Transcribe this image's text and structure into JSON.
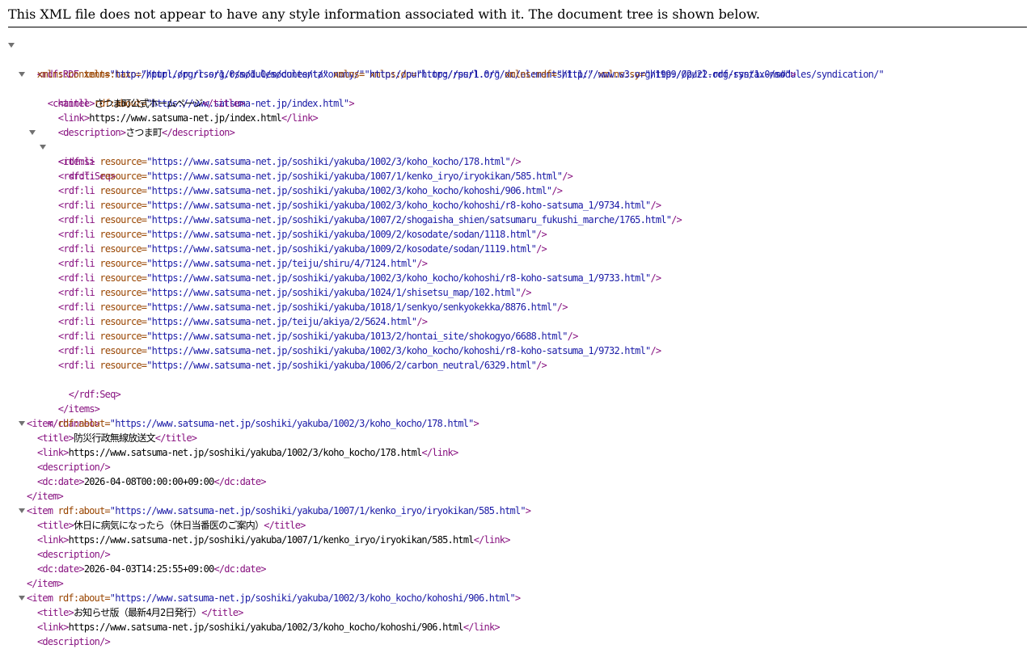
{
  "notice": "This XML file does not appear to have any style information associated with it. The document tree is shown below.",
  "tree": {
    "rdf_open": {
      "tag": "<rdf:RDF",
      "attrs1": [
        {
          "name": " xmlns:taxo=",
          "value": "\"http://purl.org/rss/1.0/modules/taxonomy/\""
        },
        {
          "name": " xmlns:dc=",
          "value": "\"http://purl.org/dc/elements/1.1/\""
        },
        {
          "name": " xmlns:sy=",
          "value": "\"http://purl.org/rss/1.0/modules/syndication/\""
        }
      ],
      "attrs2": [
        {
          "name": "xmlns:content=",
          "value": "\"http://purl.org/rss/1.0/modules/content/\""
        },
        {
          "name": " xmlns=",
          "value": "\"http://purl.org/rss/1.0/\""
        },
        {
          "name": " xmlns:rdf=",
          "value": "\"http://www.w3.org/1999/02/22-rdf-syntax-ns#\""
        }
      ],
      "close": ">"
    },
    "channel": {
      "open": "<channel",
      "attr_name": " rdf:about=",
      "attr_value": "\"https://www.satsuma-net.jp/index.html\"",
      "gt": ">",
      "title": {
        "open": "<title>",
        "text": "さつま町公式ホームページ",
        "close": "</title>"
      },
      "link": {
        "open": "<link>",
        "text": "https://www.satsuma-net.jp/index.html",
        "close": "</link>"
      },
      "description": {
        "open": "<description>",
        "text": "さつま町",
        "close": "</description>"
      },
      "items_open": "<items>",
      "seq_open": "<rdf:Seq>",
      "li_open": "<rdf:li",
      "li_attr": " resource=",
      "li_close": "/>",
      "resources": [
        "\"https://www.satsuma-net.jp/soshiki/yakuba/1002/3/koho_kocho/178.html\"",
        "\"https://www.satsuma-net.jp/soshiki/yakuba/1007/1/kenko_iryo/iryokikan/585.html\"",
        "\"https://www.satsuma-net.jp/soshiki/yakuba/1002/3/koho_kocho/kohoshi/906.html\"",
        "\"https://www.satsuma-net.jp/soshiki/yakuba/1002/3/koho_kocho/kohoshi/r8-koho-satsuma_1/9734.html\"",
        "\"https://www.satsuma-net.jp/soshiki/yakuba/1007/2/shogaisha_shien/satsumaru_fukushi_marche/1765.html\"",
        "\"https://www.satsuma-net.jp/soshiki/yakuba/1009/2/kosodate/sodan/1118.html\"",
        "\"https://www.satsuma-net.jp/soshiki/yakuba/1009/2/kosodate/sodan/1119.html\"",
        "\"https://www.satsuma-net.jp/teiju/shiru/4/7124.html\"",
        "\"https://www.satsuma-net.jp/soshiki/yakuba/1002/3/koho_kocho/kohoshi/r8-koho-satsuma_1/9733.html\"",
        "\"https://www.satsuma-net.jp/soshiki/yakuba/1024/1/shisetsu_map/102.html\"",
        "\"https://www.satsuma-net.jp/soshiki/yakuba/1018/1/senkyo/senkyokekka/8876.html\"",
        "\"https://www.satsuma-net.jp/teiju/akiya/2/5624.html\"",
        "\"https://www.satsuma-net.jp/soshiki/yakuba/1013/2/hontai_site/shokogyo/6688.html\"",
        "\"https://www.satsuma-net.jp/soshiki/yakuba/1002/3/koho_kocho/kohoshi/r8-koho-satsuma_1/9732.html\"",
        "\"https://www.satsuma-net.jp/soshiki/yakuba/1006/2/carbon_neutral/6329.html\""
      ],
      "seq_close": "</rdf:Seq>",
      "items_close": "</items>",
      "close": "</channel>"
    },
    "item_tags": {
      "open": "<item",
      "attr_name": " rdf:about=",
      "gt": ">",
      "title_open": "<title>",
      "title_close": "</title>",
      "link_open": "<link>",
      "link_close": "</link>",
      "description_empty": "<description/>",
      "date_open": "<dc:date>",
      "date_close": "</dc:date>",
      "close": "</item>"
    },
    "items": [
      {
        "about": "\"https://www.satsuma-net.jp/soshiki/yakuba/1002/3/koho_kocho/178.html\"",
        "title": "防災行政無線放送文",
        "link": "https://www.satsuma-net.jp/soshiki/yakuba/1002/3/koho_kocho/178.html",
        "date": "2026-04-08T00:00:00+09:00"
      },
      {
        "about": "\"https://www.satsuma-net.jp/soshiki/yakuba/1007/1/kenko_iryo/iryokikan/585.html\"",
        "title": "休日に病気になったら（休日当番医のご案内）",
        "link": "https://www.satsuma-net.jp/soshiki/yakuba/1007/1/kenko_iryo/iryokikan/585.html",
        "date": "2026-04-03T14:25:55+09:00"
      },
      {
        "about": "\"https://www.satsuma-net.jp/soshiki/yakuba/1002/3/koho_kocho/kohoshi/906.html\"",
        "title": "お知らせ版（最新4月2日発行）",
        "link": "https://www.satsuma-net.jp/soshiki/yakuba/1002/3/koho_kocho/kohoshi/906.html"
      }
    ]
  }
}
